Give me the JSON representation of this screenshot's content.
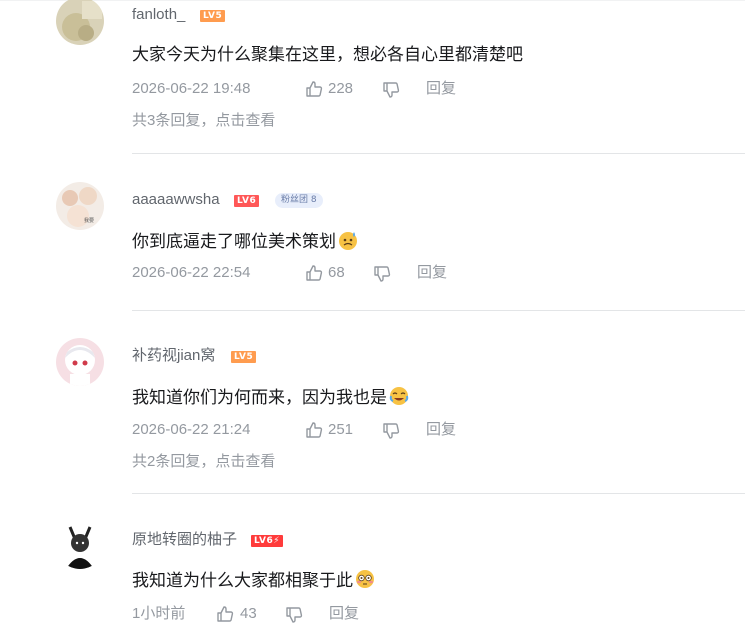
{
  "comments": [
    {
      "username": "fanloth_",
      "level": "LV5",
      "content": "大家今天为什么聚集在这里，想必各自心里都清楚吧",
      "time": "2026-06-22 19:48",
      "likes": "228",
      "reply_label": "回复",
      "sub_replies": "共3条回复，点击查看"
    },
    {
      "username": "aaaaawwsha",
      "level": "LV6",
      "badge": "粉丝团 8",
      "content": "你到底逼走了哪位美术策划",
      "time": "2026-06-22 22:54",
      "likes": "68",
      "reply_label": "回复"
    },
    {
      "username": "补药视jian窝",
      "level": "LV5",
      "content": "我知道你们为何而来，因为我也是",
      "time": "2026-06-22 21:24",
      "likes": "251",
      "reply_label": "回复",
      "sub_replies": "共2条回复，点击查看"
    },
    {
      "username": "原地转圈的柚子",
      "level": "LV6⚡",
      "content": "我知道为什么大家都相聚于此",
      "time": "1小时前",
      "likes": "43",
      "reply_label": "回复"
    }
  ],
  "icons": {
    "like": "thumb-up-icon",
    "dislike": "thumb-down-icon"
  },
  "colors": {
    "lv5": "#ff9c4f",
    "lv6": "#ff5757",
    "meta": "#9499a0",
    "username": "#61666d"
  }
}
